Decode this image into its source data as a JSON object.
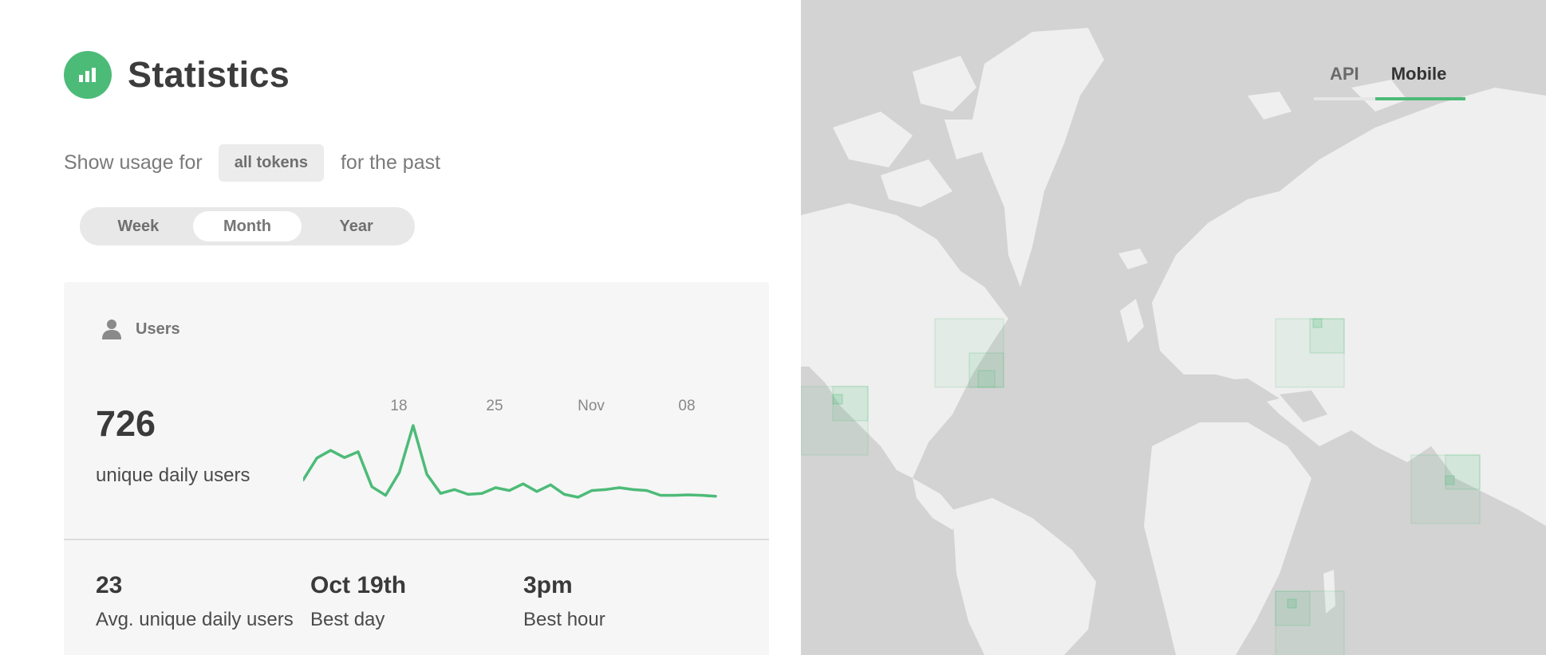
{
  "header": {
    "title": "Statistics",
    "logo_icon": "bar-chart-icon",
    "accent": "#4dbb78"
  },
  "usage": {
    "prefix": "Show usage for",
    "token_selector": "all tokens",
    "suffix": "for the past"
  },
  "period": {
    "options": [
      "Week",
      "Month",
      "Year"
    ],
    "selected": "Month"
  },
  "users_card": {
    "label": "Users",
    "icon": "user-icon",
    "value": "726",
    "value_label": "unique daily users"
  },
  "chart_data": {
    "type": "line",
    "x_tick_labels": [
      "18",
      "25",
      "Nov",
      "08"
    ],
    "series": [
      {
        "color": "#4dbb78",
        "values": [
          700,
          930,
          1010,
          935,
          995,
          630,
          540,
          780,
          1270,
          760,
          560,
          600,
          550,
          560,
          620,
          590,
          660,
          580,
          650,
          550,
          520,
          590,
          600,
          620,
          600,
          590,
          540,
          540,
          545,
          540,
          530
        ]
      }
    ],
    "grid": false,
    "legend": "none"
  },
  "stats": [
    {
      "value": "23",
      "label": "Avg. unique daily users"
    },
    {
      "value": "Oct 19th",
      "label": "Best day"
    },
    {
      "value": "3pm",
      "label": "Best hour"
    }
  ],
  "map": {
    "tabs": [
      "API",
      "Mobile"
    ],
    "active_tab": "Mobile",
    "background": "#d3d3d3",
    "land_color": "#f0f0f0",
    "marker_color": "#4dbb78"
  }
}
